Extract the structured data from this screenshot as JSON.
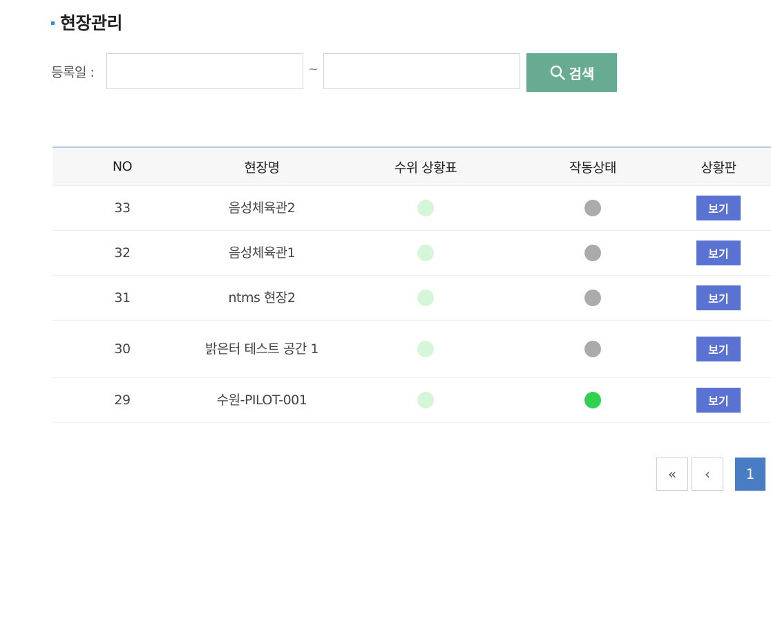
{
  "page": {
    "title": "현장관리"
  },
  "search": {
    "label": "등록일 :",
    "from_value": "",
    "to_value": "",
    "separator": "~",
    "button_label": "검색"
  },
  "table": {
    "columns": [
      "NO",
      "현장명",
      "수위 상황표",
      "작동상태",
      "상황판"
    ],
    "rows": [
      {
        "no": "33",
        "name": "음성체육관2",
        "level_color": "#d5f6d8",
        "status_color": "#a9aca9",
        "action": "보기"
      },
      {
        "no": "32",
        "name": "음성체육관1",
        "level_color": "#d5f6d8",
        "status_color": "#a9aca9",
        "action": "보기"
      },
      {
        "no": "31",
        "name": "ntms 현장2",
        "level_color": "#d5f6d8",
        "status_color": "#a9aca9",
        "action": "보기"
      },
      {
        "no": "30",
        "name": "밝은터 테스트 공간 1",
        "level_color": "#d5f6d8",
        "status_color": "#a9aca9",
        "action": "보기"
      },
      {
        "no": "29",
        "name": "수원-PILOT-001",
        "level_color": "#d5f6d8",
        "status_color": "#33d150",
        "action": "보기"
      }
    ]
  },
  "pagination": {
    "first_icon": "double-chevron-left-icon",
    "prev_icon": "chevron-left-icon",
    "first_glyph": "«",
    "prev_glyph": "‹",
    "current_page": "1"
  },
  "colors": {
    "search_button": "#66ab92",
    "view_button": "#5a73d3",
    "active_page": "#4a7cc4",
    "title_marker": "#2e8fd8"
  }
}
